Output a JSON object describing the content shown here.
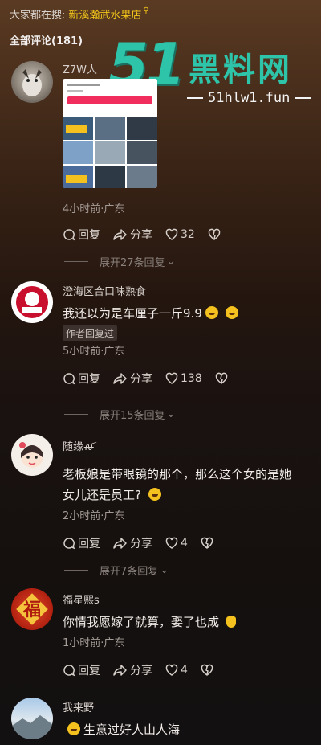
{
  "search": {
    "prefix": "大家都在搜:",
    "term": "新溪瀚武水果店"
  },
  "comments_count": "全部评论(181)",
  "watermark": {
    "big": "51",
    "brand": "黑料网",
    "url": "51hlw1.fun"
  },
  "actions": {
    "reply": "回复",
    "share": "分享"
  },
  "comments": [
    {
      "name": "Z7W人",
      "time": "4小时前·广东",
      "likes": "32",
      "expand": "展开27条回复"
    },
    {
      "name": "澄海区合口味熟食",
      "text": "我还以为是车厘子一斤9.9",
      "tag": "作者回复过",
      "time": "5小时前·广东",
      "likes": "138",
      "expand": "展开15条回复"
    },
    {
      "name": "随缘ꫛ",
      "text1": "老板娘是带眼镜的那个，那么这个女的是她",
      "text2": "女儿还是员工?",
      "time": "2小时前·广东",
      "likes": "4",
      "expand": "展开7条回复"
    },
    {
      "name": "福星熙s",
      "text": "你情我愿嫁了就算，娶了也成",
      "time": "1小时前·广东",
      "likes": "4"
    },
    {
      "name": "我来野",
      "text": "生意过好人山人海"
    }
  ],
  "colors": {
    "accent": "#f0c419",
    "brand": "#2ec4a9"
  }
}
